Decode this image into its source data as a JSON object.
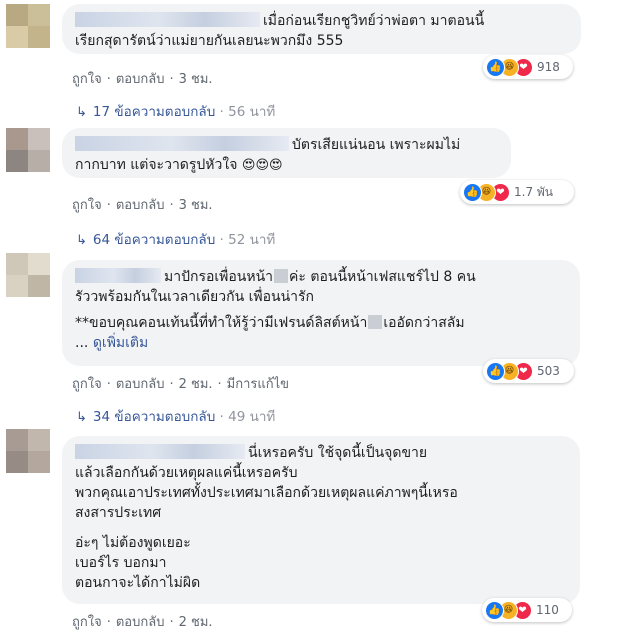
{
  "comments": [
    {
      "lines": [
        "เมื่อก่อนเรียกชูวิทย์ว่าพ่อตา มาตอนนี้",
        "เรียกสุดารัตน์ว่าแม่ยายกันเลยนะพวกมึง 555"
      ],
      "like": "ถูกใจ",
      "reply": "ตอบกลับ",
      "time": "3 ชม.",
      "reaction_count": "918",
      "replies_label": "17 ข้อความตอบกลับ",
      "replies_time": "56 นาที",
      "avatar_colors": [
        "#b9a983",
        "#cbbf9a",
        "#d8cba6",
        "#c4b48c"
      ]
    },
    {
      "lines": [
        "บัตรเสียแน่นอน เพราะผมไม่",
        "กากบาท แต่จะวาดรูปหัวใจ"
      ],
      "emoji": "😍😍😍",
      "like": "ถูกใจ",
      "reply": "ตอบกลับ",
      "time": "3 ชม.",
      "reaction_count": "1.7 พัน",
      "replies_label": "64 ข้อความตอบกลับ",
      "replies_time": "52 นาที",
      "avatar_colors": [
        "#a8988e",
        "#c9c0bb",
        "#8d8581",
        "#b7aea8"
      ]
    },
    {
      "line1_a": "มาปักรอเพื่อนหน้า",
      "line1_b": "ค่ะ ตอนนี้หน้าเฟสแชร์ไป 8 คน",
      "line2": "รัววพร้อมกันในเวลาเดียวกัน เพื่อนน่ารัก",
      "line3_a": "**ขอบคุณคอนเท้นนี้ที่ทำให้รู้ว่ามีเฟรนด์ลิสต์หน้า",
      "line3_b": "เออัดกว่าสลัม",
      "line4_a": "... ",
      "see_more": "ดูเพิ่มเติม",
      "like": "ถูกใจ",
      "reply": "ตอบกลับ",
      "time": "2 ชม.",
      "edited": "มีการแก้ไข",
      "reaction_count": "503",
      "replies_label": "34 ข้อความตอบกลับ",
      "replies_time": "49 นาที",
      "avatar_colors": [
        "#cfc7b7",
        "#e2dccf",
        "#d9d2c3",
        "#bfb6a5"
      ]
    },
    {
      "lines": [
        "นี่เหรอครับ ใช้จุดนี้เป็นจุดขาย",
        "แล้วเลือกกันด้วยเหตุผลแค่นี้เหรอครับ",
        "พวกคุณเอาประเทศทั้งประเทศมาเลือกด้วยเหตุผลแค่ภาพๆนี้เหรอ",
        "สงสารประเทศ",
        "อ่ะๆ ไม่ต้องพูดเยอะ",
        "เบอร์ไร บอกมา",
        "ตอนกาจะได้กาไม่ผิด"
      ],
      "like": "ถูกใจ",
      "reply": "ตอบกลับ",
      "time": "2 ชม.",
      "reaction_count": "110",
      "avatar_colors": [
        "#a79b93",
        "#c2b7ad",
        "#978c85",
        "#b4a89e"
      ]
    }
  ],
  "reaction_icons": [
    "like-icon",
    "haha-icon",
    "love-icon"
  ],
  "colors": {
    "bubble": "#f2f3f5",
    "link": "#385898",
    "meta": "#606770",
    "like": "#1877f2",
    "love": "#f0284a",
    "haha": "#f7b125"
  }
}
